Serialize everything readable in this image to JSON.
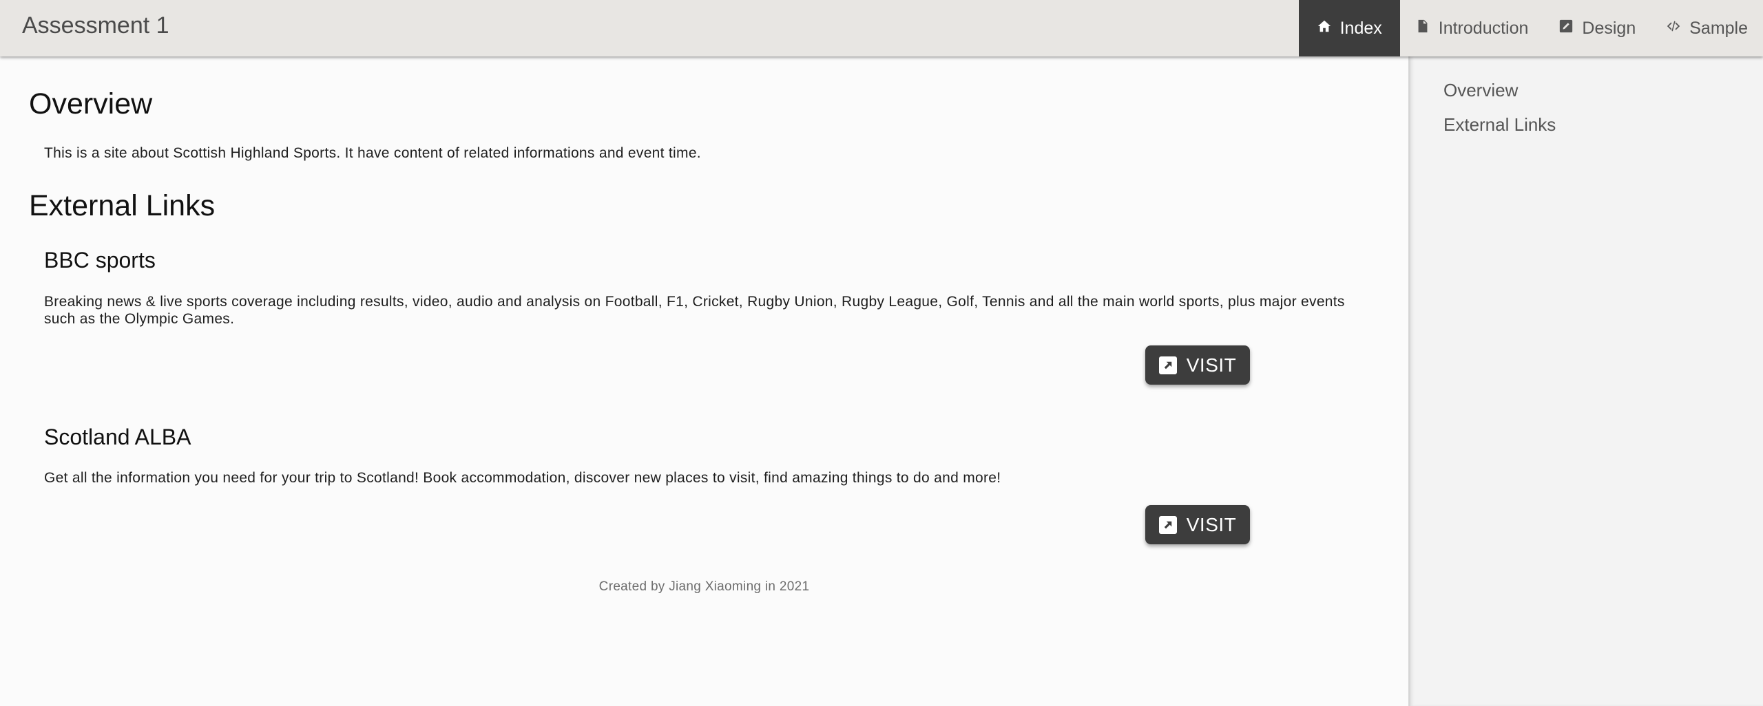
{
  "header": {
    "title": "Assessment 1",
    "tabs": [
      {
        "label": "Index",
        "icon": "home-icon",
        "active": true
      },
      {
        "label": "Introduction",
        "icon": "document-icon",
        "active": false
      },
      {
        "label": "Design",
        "icon": "edit-icon",
        "active": false
      },
      {
        "label": "Sample",
        "icon": "code-icon",
        "active": false
      }
    ]
  },
  "main": {
    "overview": {
      "heading": "Overview",
      "text": "This is a site about Scottish Highland Sports. It have content of related informations and event time."
    },
    "external_links": {
      "heading": "External Links",
      "cards": [
        {
          "title": "BBC sports",
          "description": "Breaking news & live sports coverage including results, video, audio and analysis on Football, F1, Cricket, Rugby Union, Rugby League, Golf, Tennis and all the main world sports, plus major events such as the Olympic Games.",
          "button_label": "VISIT"
        },
        {
          "title": "Scotland ALBA",
          "description": "Get all the information you need for your trip to Scotland! Book accommodation, discover new places to visit, find amazing things to do and more!",
          "button_label": "VISIT"
        }
      ]
    },
    "footer": "Created by Jiang Xiaoming in 2021"
  },
  "sidebar": {
    "items": [
      {
        "label": "Overview"
      },
      {
        "label": "External Links"
      }
    ]
  },
  "colors": {
    "header_bg": "#e8e6e3",
    "active_tab_bg": "#3d3d3d",
    "button_bg": "#3d3d3d",
    "sidebar_bg": "#f3f3f3",
    "page_bg": "#fbfbfb"
  }
}
